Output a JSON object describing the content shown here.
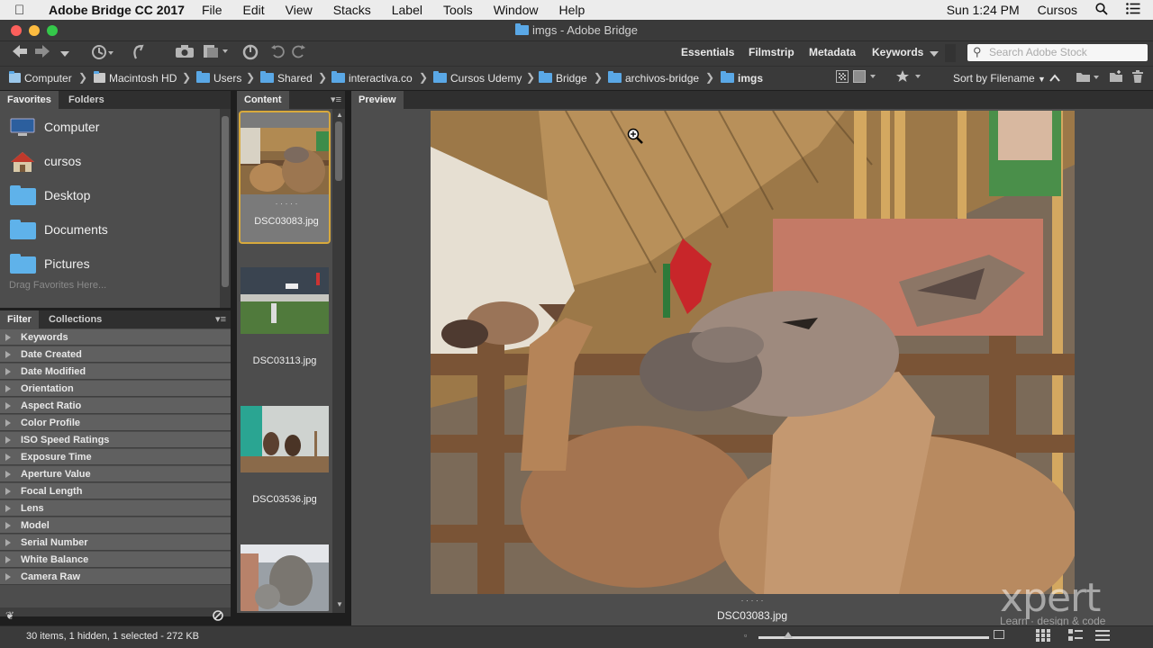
{
  "menubar": {
    "app_name": "Adobe Bridge CC 2017",
    "items": [
      "File",
      "Edit",
      "View",
      "Stacks",
      "Label",
      "Tools",
      "Window",
      "Help"
    ],
    "clock": "Sun 1:24 PM",
    "user": "Cursos"
  },
  "window": {
    "title": "imgs - Adobe Bridge"
  },
  "toolbar": {
    "workspaces": [
      "Essentials",
      "Filmstrip",
      "Metadata",
      "Keywords"
    ],
    "search_placeholder": "Search Adobe Stock"
  },
  "pathbar": {
    "crumbs": [
      "Computer",
      "Macintosh HD",
      "Users",
      "Shared",
      "interactiva.co",
      "Cursos Udemy",
      "Bridge",
      "archivos-bridge",
      "imgs"
    ],
    "sort_label": "Sort by Filename"
  },
  "favorites": {
    "tabs": [
      "Favorites",
      "Folders"
    ],
    "items": [
      "Computer",
      "cursos",
      "Desktop",
      "Documents",
      "Pictures"
    ],
    "drop_hint": "Drag Favorites Here..."
  },
  "filter": {
    "tabs": [
      "Filter",
      "Collections"
    ],
    "rows": [
      "Keywords",
      "Date Created",
      "Date Modified",
      "Orientation",
      "Aspect Ratio",
      "Color Profile",
      "ISO Speed Ratings",
      "Exposure Time",
      "Aperture Value",
      "Focal Length",
      "Lens",
      "Model",
      "Serial Number",
      "White Balance",
      "Camera Raw"
    ]
  },
  "content": {
    "tab": "Content",
    "rating_dots": "· · · · ·",
    "thumbnails": [
      {
        "name": "DSC03083.jpg",
        "selected": true
      },
      {
        "name": "DSC03113.jpg",
        "selected": false
      },
      {
        "name": "DSC03536.jpg",
        "selected": false
      },
      {
        "name": "",
        "selected": false
      }
    ]
  },
  "preview": {
    "tab": "Preview",
    "rating_dots": "· · · · ·",
    "filename": "DSC03083.jpg"
  },
  "status": {
    "summary": "30 items, 1 hidden, 1 selected - 272 KB"
  },
  "watermark": {
    "brand": "xpert",
    "tagline": "Learn · design & code"
  },
  "colors": {
    "accent_selection": "#d8a93c",
    "folder_blue": "#5fb2ea",
    "panel_gray": "#4d4d4d"
  }
}
